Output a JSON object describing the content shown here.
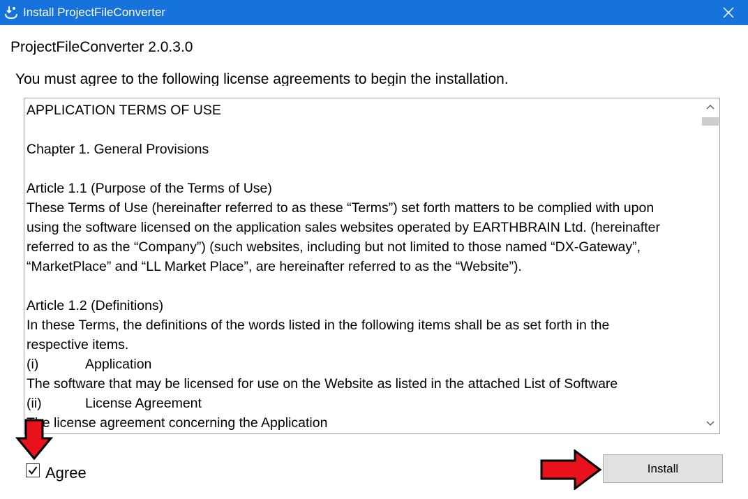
{
  "window": {
    "title": "Install ProjectFileConverter"
  },
  "product_title": "ProjectFileConverter 2.0.3.0",
  "instruction": "You must agree to the following license agreements to begin the installation.",
  "license": {
    "lines": [
      {
        "text": "APPLICATION TERMS OF USE"
      },
      {
        "text": ""
      },
      {
        "text": "Chapter 1. General Provisions"
      },
      {
        "text": ""
      },
      {
        "text": "Article 1.1 (Purpose of the Terms of Use)"
      },
      {
        "text": "These Terms of Use (hereinafter referred to as these “Terms”) set forth matters to be complied with upon"
      },
      {
        "text": "using the software licensed on the application sales websites operated by EARTHBRAIN Ltd. (hereinafter"
      },
      {
        "text": "referred to as the “Company”) (such websites, including but not limited to those named “DX-Gateway”,"
      },
      {
        "text": "“MarketPlace” and “LL Market Place”, are hereinafter referred to as the “Website”)."
      },
      {
        "text": ""
      },
      {
        "text": "Article 1.2 (Definitions)"
      },
      {
        "text": "In these Terms, the definitions of the words listed in the following items shall be as set forth in the"
      },
      {
        "text": "respective items."
      },
      {
        "num": "(i)",
        "text": "Application"
      },
      {
        "text": "The software that may be licensed for use on the Website as listed in the attached List of Software"
      },
      {
        "num": "(ii)",
        "text": "License Agreement"
      },
      {
        "text": "The license agreement concerning the Application"
      }
    ]
  },
  "agree": {
    "label": "Agree",
    "checked": true
  },
  "install_button": {
    "label": "Install"
  },
  "colors": {
    "titlebar": "#1673dc",
    "arrow_fill": "#e8121c",
    "button_bg": "#e1e1e1"
  },
  "icons": {
    "app": "installer-icon",
    "close": "close-icon",
    "scroll_up": "chevron-up-icon",
    "scroll_down": "chevron-down-icon",
    "check": "checkmark-icon"
  }
}
